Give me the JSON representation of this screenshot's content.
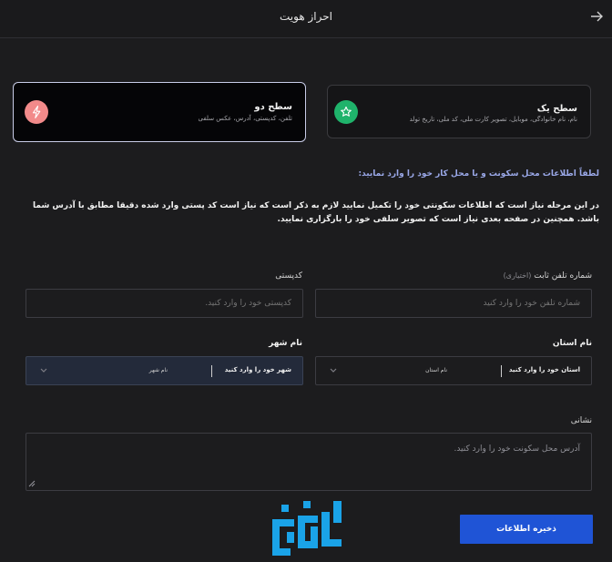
{
  "header": {
    "title": "احراز هویت",
    "back_icon": "arrow-right-icon"
  },
  "levels": {
    "one": {
      "title": "سطح یک",
      "description": "نام، نام خانوادگی، موبایل، تصویر کارت ملی، کد ملی، تاریخ تولد",
      "icon": "star-icon",
      "icon_color": "#1fb36b"
    },
    "two": {
      "title": "سطح دو",
      "description": "تلفن، کدپستی، آدرس، عکس سلفی",
      "icon": "lightning-icon",
      "icon_color": "#f28a8a"
    }
  },
  "prompt": "لطفاً اطلاعات محل سکونت و یا محل کار خود را وارد نمایید:",
  "info_text": "در این مرحله نیاز است که اطلاعات سکونتی خود را تکمیل نمایید لازم به ذکر است که نیاز است کد پستی وارد شده دقیقا مطابق با آدرس شما باشد. همچنین در صفحه بعدی نیاز است که تصویر سلفی خود را بارگزاری نمایید.",
  "form": {
    "phone": {
      "label": "شماره تلفن ثابت",
      "optional": "(اختیاری)",
      "placeholder": "شماره تلفن خود را وارد کنید"
    },
    "postal": {
      "label": "کدپستی",
      "placeholder": "کدپستی خود را وارد کنید."
    },
    "province": {
      "label": "نام استان",
      "value": "استان خود را وارد کنید",
      "sub": "نام استان"
    },
    "city": {
      "label": "نام شهر",
      "value": "شهر خود را وارد کنید",
      "sub": "نام شهر"
    },
    "address": {
      "label": "نشانی",
      "placeholder": "آدرس محل سکونت خود را وارد کنید."
    }
  },
  "save_label": "ذخیره اطلاعات",
  "colors": {
    "accent": "#1f54d6",
    "prompt": "#9aa8e8",
    "logo": "#1aa3e8"
  }
}
